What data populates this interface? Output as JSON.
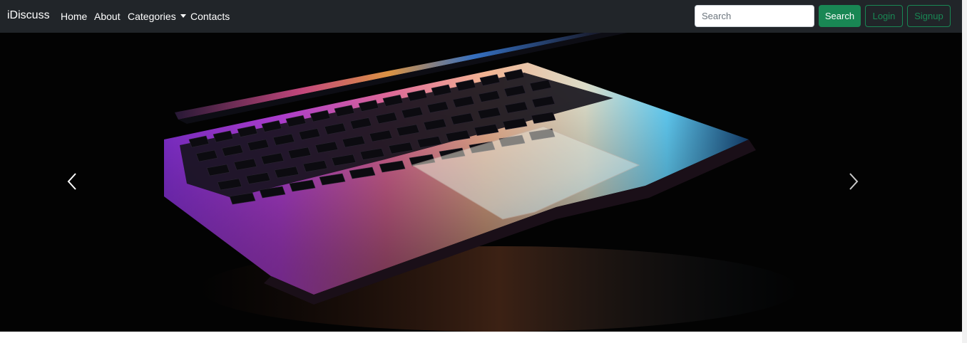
{
  "navbar": {
    "brand": "iDiscuss",
    "links": [
      "Home",
      "About",
      "Categories",
      "Contacts"
    ],
    "search": {
      "placeholder": "Search",
      "value": ""
    },
    "buttons": {
      "search": "Search",
      "login": "Login",
      "signup": "Signup"
    }
  },
  "carousel": {
    "image": "laptop-keyboard-photo",
    "controls": {
      "prev": "chevron-left-icon",
      "next": "chevron-right-icon"
    }
  },
  "colors": {
    "navbar_bg": "#212529",
    "success": "#198754",
    "carousel_bg": "#030303"
  }
}
